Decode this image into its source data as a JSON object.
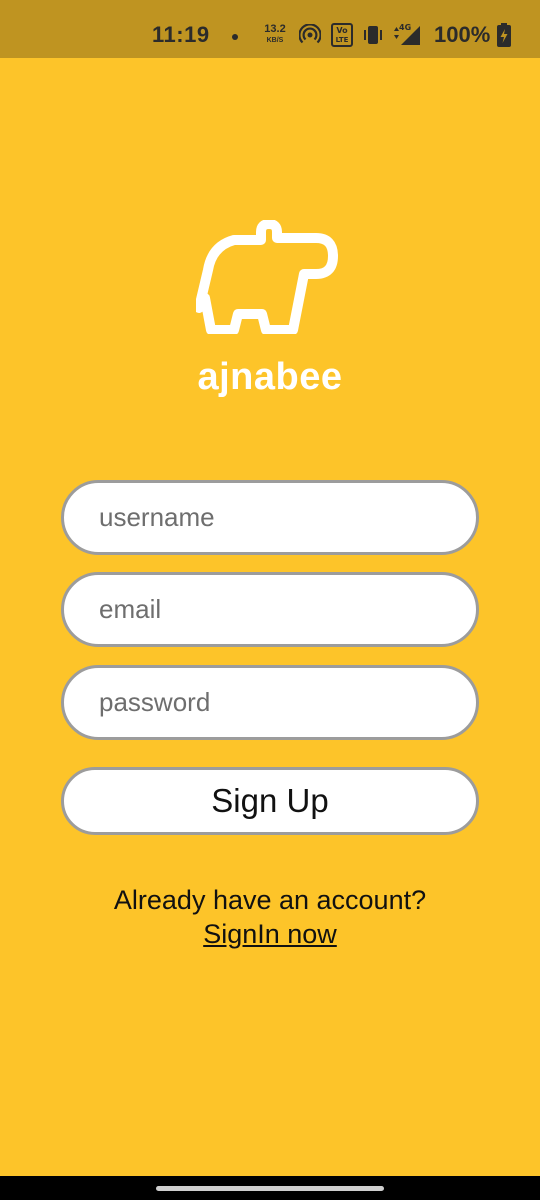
{
  "status_bar": {
    "time": "11:19",
    "net_speed_value": "13.2",
    "net_speed_unit": "KB/S",
    "battery": "100%",
    "icons": [
      "hotspot-icon",
      "volte-icon",
      "vibrate-icon",
      "signal-4g-icon",
      "battery-charging-icon"
    ]
  },
  "app": {
    "name": "ajnabee",
    "logo": "hippo-logo"
  },
  "form": {
    "username_placeholder": "username",
    "email_placeholder": "email",
    "password_placeholder": "password",
    "submit_label": "Sign Up"
  },
  "footer": {
    "prompt": "Already have an account?",
    "link_label": "SignIn now"
  },
  "colors": {
    "background": "#FDC429",
    "status_bar": "#BF9421",
    "field_border": "#9C9C9C"
  }
}
